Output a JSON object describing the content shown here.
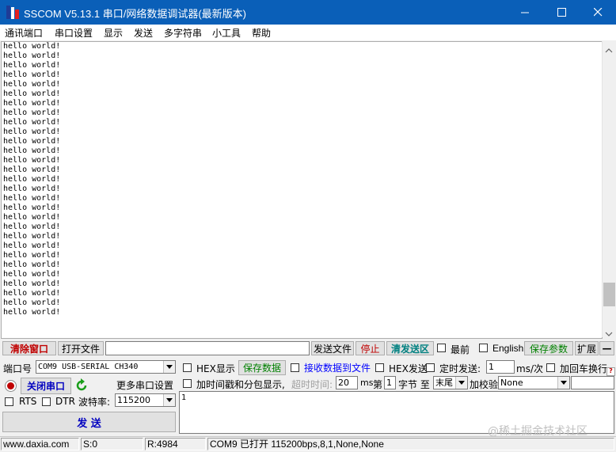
{
  "window": {
    "title": "SSCOM V5.13.1 串口/网络数据调试器(最新版本)",
    "accent": "#0a5fb8"
  },
  "menu": [
    "通讯端口",
    "串口设置",
    "显示",
    "发送",
    "多字符串",
    "小工具",
    "帮助"
  ],
  "receive": {
    "lines": [
      "hello world!",
      "hello world!",
      "hello world!",
      "hello world!",
      "hello world!",
      "hello world!",
      "hello world!",
      "hello world!",
      "hello world!",
      "hello world!",
      "hello world!",
      "hello world!",
      "hello world!",
      "hello world!",
      "hello world!",
      "hello world!",
      "hello world!",
      "hello world!",
      "hello world!",
      "hello world!",
      "hello world!",
      "hello world!",
      "hello world!",
      "hello world!",
      "hello world!",
      "hello world!",
      "hello world!",
      "hello world!",
      "hello world!"
    ],
    "scroll_position": 0.93
  },
  "toolbar": {
    "clear_window": "清除窗口",
    "open_file": "打开文件",
    "file_path": "",
    "send_file": "发送文件",
    "stop": "停止",
    "clear_send": "清发送区",
    "topmost": "最前",
    "english": "English",
    "save_params": "保存参数",
    "expand": "扩展",
    "collapse": "—"
  },
  "port": {
    "label": "端口号",
    "value": "COM9 USB-SERIAL CH340",
    "close_port": "关闭串口",
    "more_settings": "更多串口设置",
    "rts": "RTS",
    "dtr": "DTR",
    "baud_label": "波特率:",
    "baud_value": "115200",
    "send": "发 送"
  },
  "options": {
    "hex_display": "HEX显示",
    "save_data": "保存数据",
    "recv_to_file": "接收数据到文件",
    "hex_send": "HEX发送",
    "timed_send": "定时发送:",
    "interval_value": "1",
    "interval_unit": "ms/次",
    "add_crlf": "加回车换行",
    "timestamp": "加时间戳和分包显示,",
    "timeout_label": "超时时间:",
    "timeout_value": "20",
    "timeout_unit": "ms",
    "byte_prefix": "第",
    "byte_index": "1",
    "byte_suffix": "字节 至",
    "tail": "末尾",
    "checksum_label": "加校验",
    "checksum_value": "None"
  },
  "send_text": "1",
  "status": {
    "website": "www.daxia.com",
    "sent": "S:0",
    "received": "R:4984",
    "port_info": "COM9 已打开  115200bps,8,1,None,None"
  },
  "watermark": "@稀土掘金技术社区"
}
